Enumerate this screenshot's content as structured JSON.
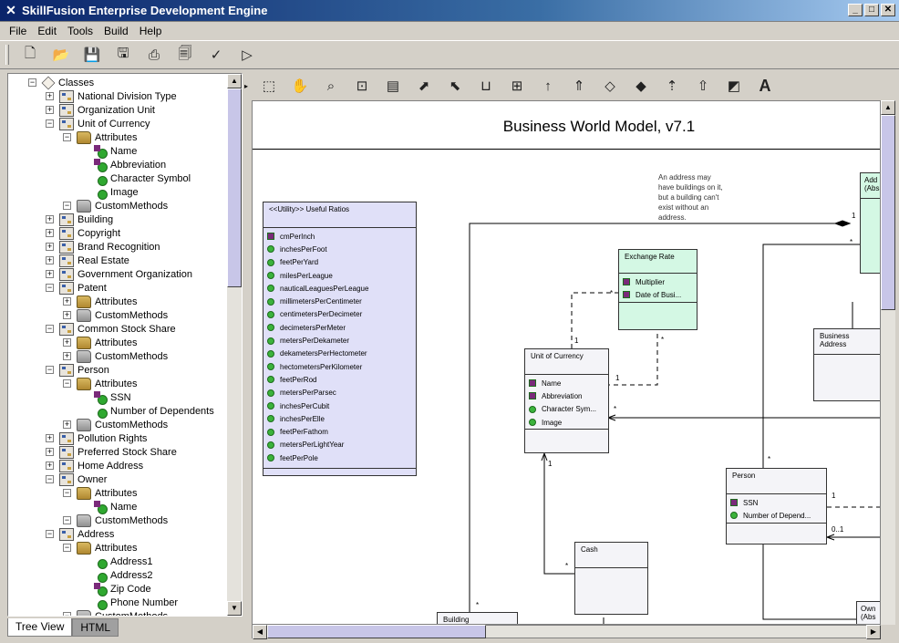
{
  "window": {
    "title": "SkillFusion Enterprise Development Engine",
    "min": "_",
    "max": "□",
    "close": "✕"
  },
  "menu": [
    "File",
    "Edit",
    "Tools",
    "Build",
    "Help"
  ],
  "tree": {
    "rows": [
      {
        "label": "Classes",
        "indent": 0,
        "exp": "−",
        "icon": "root"
      },
      {
        "label": "National Division Type",
        "indent": 1,
        "exp": "+",
        "icon": "class"
      },
      {
        "label": "Organization Unit",
        "indent": 1,
        "exp": "+",
        "icon": "class"
      },
      {
        "label": "Unit of Currency",
        "indent": 1,
        "exp": "−",
        "icon": "class"
      },
      {
        "label": "Attributes",
        "indent": 2,
        "exp": "−",
        "icon": "folder"
      },
      {
        "label": "Name",
        "indent": 3,
        "exp": "",
        "icon": "attr-key"
      },
      {
        "label": "Abbreviation",
        "indent": 3,
        "exp": "",
        "icon": "attr-key"
      },
      {
        "label": "Character Symbol",
        "indent": 3,
        "exp": "",
        "icon": "attr"
      },
      {
        "label": "Image",
        "indent": 3,
        "exp": "",
        "icon": "attr"
      },
      {
        "label": "CustomMethods",
        "indent": 2,
        "exp": "−",
        "icon": "folder2"
      },
      {
        "label": "Building",
        "indent": 1,
        "exp": "+",
        "icon": "class"
      },
      {
        "label": "Copyright",
        "indent": 1,
        "exp": "+",
        "icon": "class"
      },
      {
        "label": "Brand Recognition",
        "indent": 1,
        "exp": "+",
        "icon": "class"
      },
      {
        "label": "Real Estate",
        "indent": 1,
        "exp": "+",
        "icon": "class"
      },
      {
        "label": "Government Organization",
        "indent": 1,
        "exp": "+",
        "icon": "class"
      },
      {
        "label": "Patent",
        "indent": 1,
        "exp": "−",
        "icon": "class"
      },
      {
        "label": "Attributes",
        "indent": 2,
        "exp": "+",
        "icon": "folder"
      },
      {
        "label": "CustomMethods",
        "indent": 2,
        "exp": "+",
        "icon": "folder2"
      },
      {
        "label": "Common Stock Share",
        "indent": 1,
        "exp": "−",
        "icon": "class"
      },
      {
        "label": "Attributes",
        "indent": 2,
        "exp": "+",
        "icon": "folder"
      },
      {
        "label": "CustomMethods",
        "indent": 2,
        "exp": "+",
        "icon": "folder2"
      },
      {
        "label": "Person",
        "indent": 1,
        "exp": "−",
        "icon": "class"
      },
      {
        "label": "Attributes",
        "indent": 2,
        "exp": "−",
        "icon": "folder"
      },
      {
        "label": "SSN",
        "indent": 3,
        "exp": "",
        "icon": "attr-key"
      },
      {
        "label": "Number of Dependents",
        "indent": 3,
        "exp": "",
        "icon": "attr"
      },
      {
        "label": "CustomMethods",
        "indent": 2,
        "exp": "+",
        "icon": "folder2"
      },
      {
        "label": "Pollution Rights",
        "indent": 1,
        "exp": "+",
        "icon": "class"
      },
      {
        "label": "Preferred Stock Share",
        "indent": 1,
        "exp": "+",
        "icon": "class"
      },
      {
        "label": "Home Address",
        "indent": 1,
        "exp": "+",
        "icon": "class"
      },
      {
        "label": "Owner",
        "indent": 1,
        "exp": "−",
        "icon": "class"
      },
      {
        "label": "Attributes",
        "indent": 2,
        "exp": "−",
        "icon": "folder"
      },
      {
        "label": "Name",
        "indent": 3,
        "exp": "",
        "icon": "attr-key"
      },
      {
        "label": "CustomMethods",
        "indent": 2,
        "exp": "−",
        "icon": "folder2"
      },
      {
        "label": "Address",
        "indent": 1,
        "exp": "−",
        "icon": "class"
      },
      {
        "label": "Attributes",
        "indent": 2,
        "exp": "−",
        "icon": "folder"
      },
      {
        "label": "Address1",
        "indent": 3,
        "exp": "",
        "icon": "attr"
      },
      {
        "label": "Address2",
        "indent": 3,
        "exp": "",
        "icon": "attr"
      },
      {
        "label": "Zip Code",
        "indent": 3,
        "exp": "",
        "icon": "attr-key"
      },
      {
        "label": "Phone Number",
        "indent": 3,
        "exp": "",
        "icon": "attr"
      },
      {
        "label": "CustomMethods",
        "indent": 2,
        "exp": "−",
        "icon": "folder2"
      }
    ]
  },
  "tabs": {
    "tree_view": "Tree View",
    "html": "HTML"
  },
  "diagram": {
    "title": "Business World Model, v7.1",
    "note": [
      "An address may",
      "have buildings on it,",
      "but a building can't",
      "exist without an",
      "address."
    ],
    "utility": {
      "header": "<<Utility>>  Useful Ratios",
      "items": [
        "cmPerInch",
        "inchesPerFoot",
        "feetPerYard",
        "milesPerLeague",
        "nauticalLeaguesPerLeague",
        "millimetersPerCentimeter",
        "centimetersPerDecimeter",
        "decimetersPerMeter",
        "metersPerDekameter",
        "dekametersPerHectometer",
        "hectometersPerKilometer",
        "feetPerRod",
        "metersPerParsec",
        "inchesPerCubit",
        "inchesPerElle",
        "feetPerFathom",
        "metersPerLightYear",
        "feetPerPole"
      ]
    },
    "exchange": {
      "header": "Exchange Rate",
      "items": [
        "Multiplier",
        "Date of Busi..."
      ]
    },
    "currency": {
      "header": "Unit of Currency",
      "items": [
        "Name",
        "Abbreviation",
        "Character Sym...",
        "Image"
      ]
    },
    "business_address": {
      "header": "Business Address"
    },
    "person": {
      "header": "Person",
      "items": [
        "SSN",
        "Number of Depend..."
      ]
    },
    "cash": {
      "header": "Cash"
    },
    "building": {
      "header": "Building"
    },
    "address_partial": {
      "header": "Add",
      "sub": "(Abs"
    },
    "owner_partial": {
      "header": "Own",
      "sub": "(Abs"
    },
    "multiplicities": {
      "m1": "1",
      "m2": "*",
      "m3": "1",
      "m4": "*",
      "m5": "*",
      "m6": "1",
      "m7": "*",
      "m8": "1",
      "m9": "*",
      "m10": "1",
      "m11": "0..1",
      "m12": "*",
      "m13": "*"
    },
    "colors": {
      "utility": "#e0e0f8",
      "exchange": "#d4f8e4"
    }
  }
}
